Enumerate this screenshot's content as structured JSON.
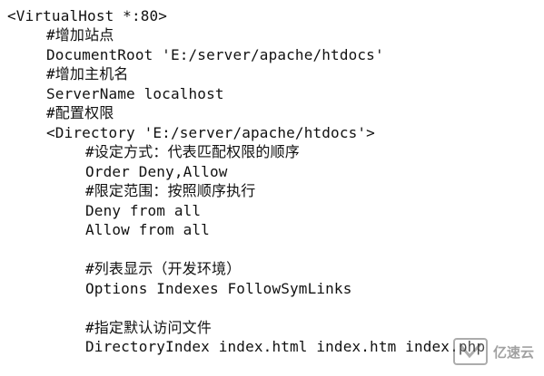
{
  "code": {
    "lines": [
      "<VirtualHost *:80>",
      "#增加站点",
      "DocumentRoot 'E:/server/apache/htdocs'",
      "#增加主机名",
      "ServerName localhost",
      "#配置权限",
      "<Directory 'E:/server/apache/htdocs'>",
      "#设定方式：代表匹配权限的顺序",
      "Order Deny,Allow",
      "#限定范围：按照顺序执行",
      "Deny from all",
      "Allow from all",
      "#列表显示（开发环境）",
      "Options Indexes FollowSymLinks",
      "#指定默认访问文件",
      "DirectoryIndex index.html index.htm index.php"
    ]
  },
  "watermark": {
    "text": "亿速云"
  }
}
